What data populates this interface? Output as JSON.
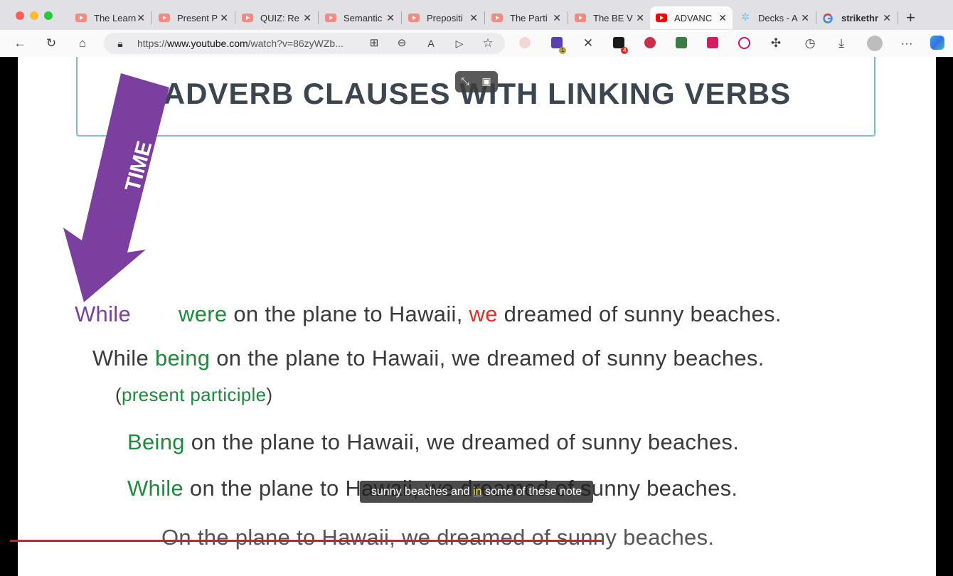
{
  "tabs": [
    {
      "title": "The Learn",
      "icon": "youtube-icon"
    },
    {
      "title": "Present P",
      "icon": "youtube-icon"
    },
    {
      "title": "QUIZ: Re",
      "icon": "youtube-icon"
    },
    {
      "title": "Semantic",
      "icon": "youtube-icon"
    },
    {
      "title": "Prepositi",
      "icon": "youtube-icon"
    },
    {
      "title": "The Parti",
      "icon": "youtube-icon"
    },
    {
      "title": "The BE V",
      "icon": "youtube-icon"
    },
    {
      "title": "ADVANC",
      "icon": "youtube-icon",
      "active": true
    },
    {
      "title": "Decks - A",
      "icon": "decks-icon"
    },
    {
      "title": "strikethr",
      "icon": "google-icon"
    }
  ],
  "toolbar": {
    "url_prefix": "https://",
    "url_host": "www.youtube.com",
    "url_path": "/watch?v=86zyWZb...",
    "ext_badge_1": "1",
    "ext_badge_2": "4"
  },
  "slide": {
    "title": "ADVERB CLAUSES WITH LINKING VERBS",
    "arrow_label": "TIME",
    "line1": {
      "w1": "While",
      "w2": "were",
      "mid": " on the plane to Hawaii, ",
      "w3": "we",
      "end": " dreamed of sunny beaches."
    },
    "line2": {
      "a": "While ",
      "b": "being",
      "c": " on the plane to Hawaii, we dreamed of sunny beaches."
    },
    "line2_note": {
      "open": "(",
      "text": "present participle",
      "close": ")"
    },
    "line3": {
      "a": "Being",
      "b": " on the plane to Hawaii, we dreamed of sunny beaches."
    },
    "line4": {
      "a": "While",
      "b": " on the plane to Hawaii, we dreamed of sunny beaches."
    },
    "line5": {
      "text": "On the plane to Hawaii, we dreamed of sunny beaches."
    }
  },
  "caption": {
    "pre": "sunny beaches and ",
    "hl": "in",
    "post": " some of these note"
  },
  "colors": {
    "purple": "#7b3fa0",
    "green": "#1e8a3c",
    "red": "#d9302a",
    "strike": "#e5161a"
  }
}
